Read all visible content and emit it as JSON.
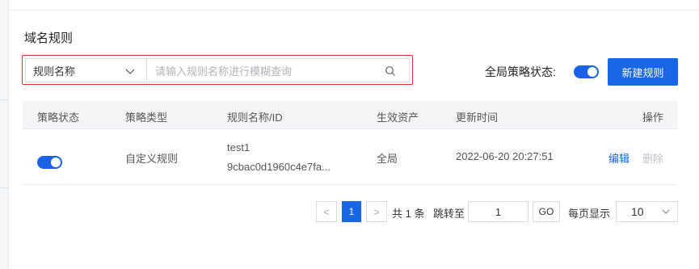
{
  "title": "域名规则",
  "search": {
    "select_value": "规则名称",
    "placeholder": "请输入规则名称进行模糊查询"
  },
  "global_policy": {
    "label": "全局策略状态:",
    "enabled": true
  },
  "new_rule_button": "新建规则",
  "table": {
    "headers": [
      "策略状态",
      "策略类型",
      "规则名称/ID",
      "生效资产",
      "更新时间",
      "操作"
    ],
    "rows": [
      {
        "enabled": true,
        "type": "自定义规则",
        "name": "test1",
        "id": "9cbac0d1960c4e7fa...",
        "asset": "全局",
        "updated": "2022-06-20 20:27:51",
        "edit": "编辑",
        "delete": "删除"
      }
    ]
  },
  "pagination": {
    "prev": "<",
    "current_page": "1",
    "next": ">",
    "total": "共 1 条",
    "jump_label": "跳转至",
    "jump_value": "1",
    "go": "GO",
    "page_size_label": "每页显示",
    "page_size": "10"
  },
  "colors": {
    "primary": "#1967e5",
    "highlight_border": "#e0312f"
  }
}
